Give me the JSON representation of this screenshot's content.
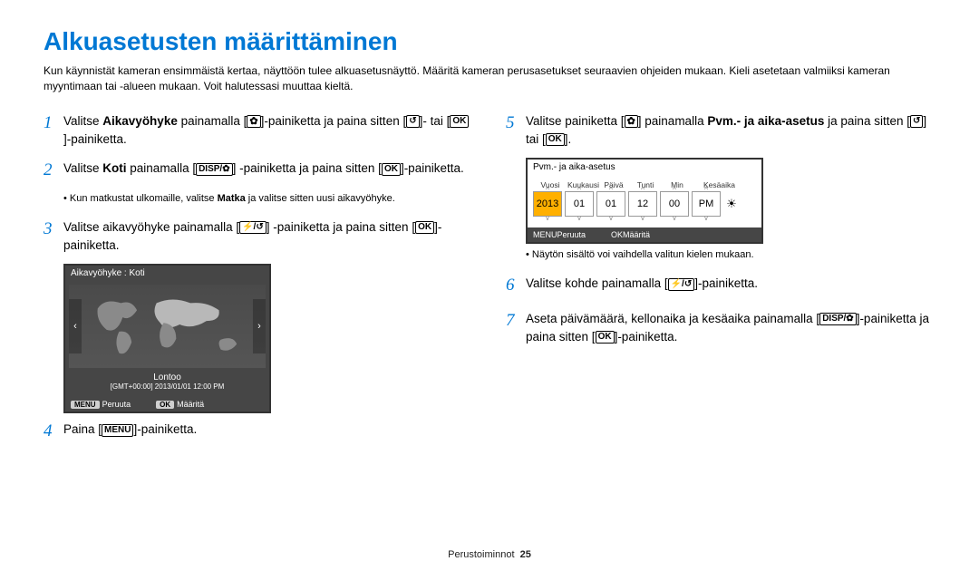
{
  "title": "Alkuasetusten määrittäminen",
  "intro": "Kun käynnistät kameran ensimmäistä kertaa, näyttöön tulee alkuasetusnäyttö. Määritä kameran perusasetukset seuraavien ohjeiden mukaan. Kieli asetetaan valmiiksi kameran myyntimaan tai -alueen mukaan. Voit halutessasi muuttaa kieltä.",
  "steps": {
    "s1a": "Valitse ",
    "s1b": "Aikavyöhyke",
    "s1c": " painamalla [",
    "s1d": "]-painiketta ja paina sitten [",
    "s1e": "]- tai [",
    "s1f": "]-painiketta.",
    "s2a": "Valitse ",
    "s2b": "Koti",
    "s2c": " painamalla [",
    "s2d": "] -painiketta ja paina sitten [",
    "s2e": "]-painiketta.",
    "s2note": "Kun matkustat ulkomaille, valitse ",
    "s2noteb": "Matka",
    "s2notec": " ja valitse sitten uusi aikavyöhyke.",
    "s3a": "Valitse aikavyöhyke painamalla [",
    "s3b": "] -painiketta ja paina sitten [",
    "s3c": "]-painiketta.",
    "s4a": "Paina [",
    "s4b": "]-painiketta.",
    "s5a": "Valitse painiketta [",
    "s5b": "] painamalla ",
    "s5c": "Pvm.- ja aika-asetus",
    "s5d": " ja paina sitten [",
    "s5e": "] tai [",
    "s5f": "].",
    "s5note": "Näytön sisältö voi vaihdella valitun kielen mukaan.",
    "s6a": "Valitse kohde painamalla [",
    "s6b": "]-painiketta.",
    "s7a": "Aseta päivämäärä, kellonaika ja kesäaika painamalla [",
    "s7b": "]-painiketta ja paina sitten [",
    "s7c": "]-painiketta."
  },
  "icons": {
    "macro": "✿",
    "timer": "↺",
    "ok": "OK",
    "disp_macro": "DISP/✿",
    "flash_timer": "⚡/↺",
    "menu": "MENU"
  },
  "mapscreen": {
    "title": "Aikavyöhyke : Koti",
    "city": "Lontoo",
    "stamp": "[GMT+00:00] 2013/01/01 12:00 PM",
    "left": "‹",
    "right": "›",
    "cancel": "Peruuta",
    "set": "Määritä",
    "menu": "MENU",
    "ok": "OK"
  },
  "datescreen": {
    "title": "Pvm.- ja aika-asetus",
    "cols": [
      "Vuosi",
      "Kuukausi",
      "Päivä",
      "Tunti",
      "Min",
      "Kesäaika"
    ],
    "vals": [
      "2013",
      "01",
      "01",
      "12",
      "00",
      "PM"
    ],
    "cancel": "Peruuta",
    "set": "Määritä",
    "menu": "MENU",
    "ok": "OK",
    "dst": "☀"
  },
  "footer": {
    "section": "Perustoiminnot",
    "page": "25"
  }
}
